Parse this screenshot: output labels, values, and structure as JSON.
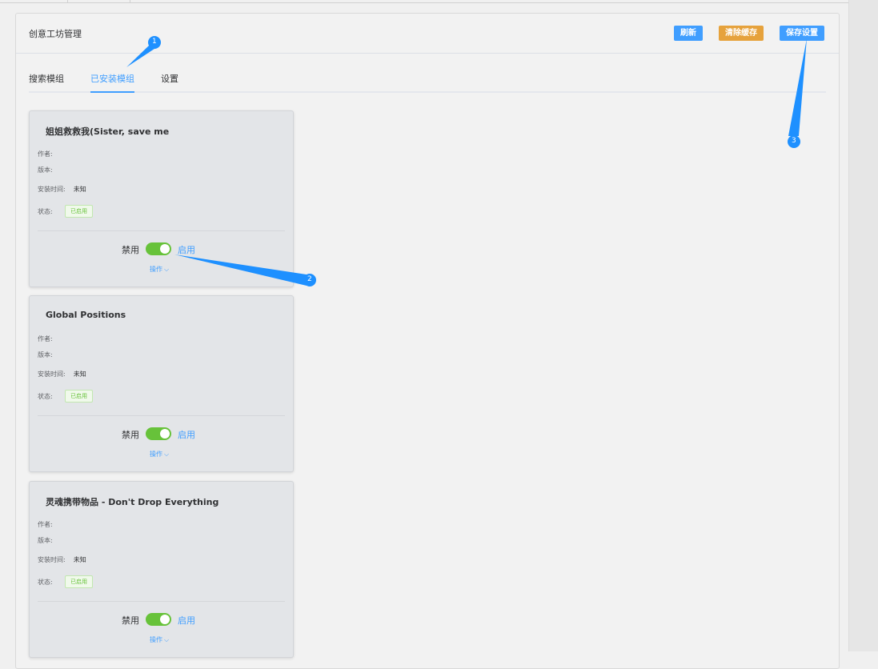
{
  "header": {
    "title": "创意工坊管理",
    "refresh_label": "刷新",
    "clear_cache_label": "清除缓存",
    "save_label": "保存设置"
  },
  "tabs": [
    {
      "label": "搜索模组",
      "active": false
    },
    {
      "label": "已安装模组",
      "active": true
    },
    {
      "label": "设置",
      "active": false
    }
  ],
  "field_labels": {
    "author": "作者:",
    "version": "版本:",
    "install_time": "安装时间:",
    "status": "状态:"
  },
  "mods": [
    {
      "title": "姐姐救救我(Sister, save me",
      "author": "",
      "version": "",
      "install_time": "未知",
      "status": "已启用",
      "switch_off_label": "禁用",
      "switch_on_label": "启用",
      "enabled": true,
      "ops_label": "操作"
    },
    {
      "title": "Global Positions",
      "author": "",
      "version": "",
      "install_time": "未知",
      "status": "已启用",
      "switch_off_label": "禁用",
      "switch_on_label": "启用",
      "enabled": true,
      "ops_label": "操作"
    },
    {
      "title": "灵魂携带物品 - Don't Drop Everything",
      "author": "",
      "version": "",
      "install_time": "未知",
      "status": "已启用",
      "switch_off_label": "禁用",
      "switch_on_label": "启用",
      "enabled": true,
      "ops_label": "操作"
    }
  ],
  "callouts": [
    "1",
    "2",
    "3"
  ],
  "colors": {
    "primary": "#409eff",
    "warning": "#e6a23c",
    "success": "#67c23a",
    "callout": "#1e90ff"
  }
}
